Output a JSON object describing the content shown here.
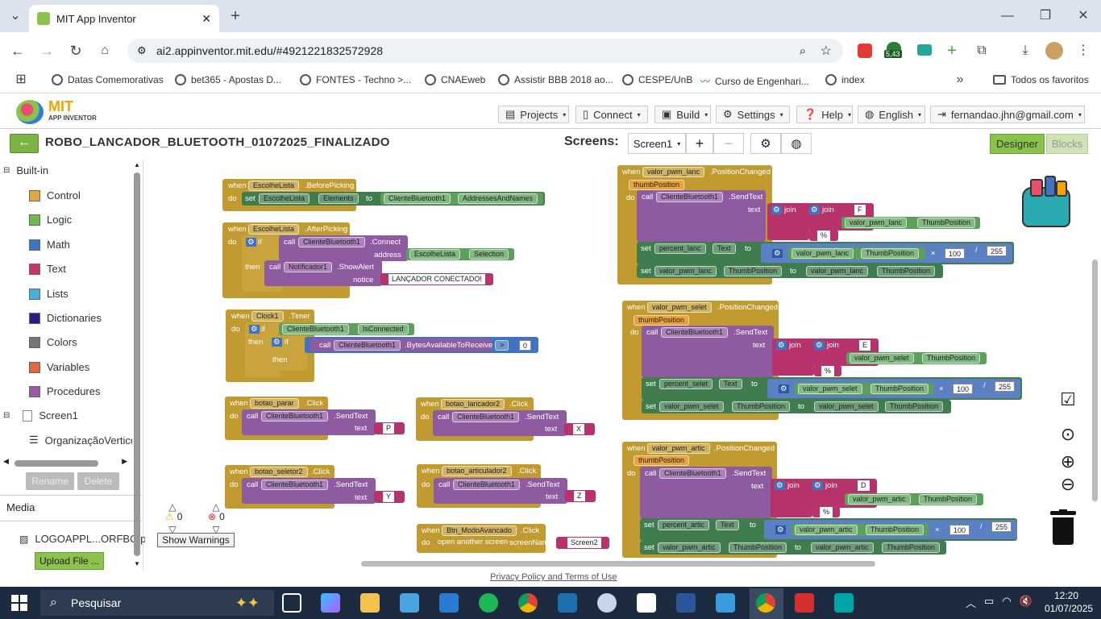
{
  "browser": {
    "tab_title": "MIT App Inventor",
    "url": "ai2.appinventor.mit.edu/#4921221832572928",
    "ext_badge": "5,43",
    "bookmarks": [
      "Datas Comemorativas",
      "bet365 - Apostas D...",
      "FONTES - Techno >...",
      "CNAEweb",
      "Assistir BBB 2018 ao...",
      "CESPE/UnB",
      "Curso de Engenhari...",
      "index"
    ],
    "all_bookmarks": "Todos os favoritos"
  },
  "app": {
    "logo_title": "MIT",
    "logo_sub": "APP INVENTOR",
    "menus": [
      "Projects",
      "Connect",
      "Build",
      "Settings",
      "Help",
      "English",
      "fernandao.jhn@gmail.com"
    ],
    "project_name": "ROBO_LANCADOR_BLUETOOTH_01072025_FINALIZADO",
    "screens_label": "Screens:",
    "screen_select": "Screen1",
    "designer": "Designer",
    "blocks": "Blocks"
  },
  "left": {
    "builtin": "Built-in",
    "categories": [
      {
        "label": "Control",
        "color": "#e0a83a"
      },
      {
        "label": "Logic",
        "color": "#6dbb4a"
      },
      {
        "label": "Math",
        "color": "#3f74c3"
      },
      {
        "label": "Text",
        "color": "#c8356d"
      },
      {
        "label": "Lists",
        "color": "#45b0d9"
      },
      {
        "label": "Dictionaries",
        "color": "#2a1b8e"
      },
      {
        "label": "Colors",
        "color": "#777777"
      },
      {
        "label": "Variables",
        "color": "#e2673a"
      },
      {
        "label": "Procedures",
        "color": "#9a5aa8"
      }
    ],
    "screen1": "Screen1",
    "org": "OrganizaçãoVertico",
    "rename": "Rename",
    "delete": "Delete",
    "media": "Media",
    "media_file": "LOGOAPPL...ORFBC.png",
    "upload": "Upload File ..."
  },
  "workspace": {
    "warnings": "0",
    "errors": "0",
    "show_warnings": "Show Warnings",
    "privacy": "Privacy Policy and Terms of Use",
    "b1": {
      "when": "when",
      "comp": "EscolheLista",
      "event": ".BeforePicking",
      "do": "do",
      "set": "set",
      "comp2": "EscolheLista",
      "prop": "Elements",
      "to": "to",
      "comp3": "ClienteBluetooth1",
      "prop2": "AddressesAndNames"
    },
    "b2": {
      "when": "when",
      "comp": "EscolheLista",
      "event": ".AfterPicking",
      "do": "do",
      "if": "if",
      "call": "call",
      "comp2": "ClienteBluetooth1",
      "method": ".Connect",
      "address": "address",
      "comp3": "EscolheLista",
      "prop": "Selection",
      "then": "then",
      "comp4": "Notificador1",
      "method2": ".ShowAlert",
      "notice": "notice",
      "text": "LANÇADOR CONECTADO!"
    },
    "b3": {
      "when": "when",
      "comp": "Clock1",
      "event": ".Timer",
      "do": "do",
      "if": "if",
      "comp2": "ClienteBluetooth1",
      "prop": "IsConnected",
      "then": "then",
      "if2": "if",
      "call": "call",
      "comp3": "ClienteBluetooth1",
      "method": ".BytesAvailableToReceive",
      "op": ">",
      "num": "0",
      "then2": "then"
    },
    "b4": {
      "when": "when",
      "comp": "botao_parar",
      "event": ".Click",
      "do": "do",
      "call": "call",
      "comp2": "ClienteBluetooth1",
      "method": ".SendText",
      "text": "text",
      "val": "P"
    },
    "b5": {
      "when": "when",
      "comp": "botao_lancador2",
      "event": ".Click",
      "do": "do",
      "call": "call",
      "comp2": "ClienteBluetooth1",
      "method": ".SendText",
      "text": "text",
      "val": "X"
    },
    "b6": {
      "when": "when",
      "comp": "botao_seletor2",
      "event": ".Click",
      "do": "do",
      "call": "call",
      "comp2": "ClienteBluetooth1",
      "method": ".SendText",
      "text": "text",
      "val": "Y"
    },
    "b7": {
      "when": "when",
      "comp": "botao_articulador2",
      "event": ".Click",
      "do": "do",
      "call": "call",
      "comp2": "ClienteBluetooth1",
      "method": ".SendText",
      "text": "text",
      "val": "Z"
    },
    "b8": {
      "when": "when",
      "comp": "Btn_ModoAvancado",
      "event": ".Click",
      "do": "do",
      "action": "open another screen",
      "screenName": "screenName",
      "val": "Screen2"
    },
    "b9": {
      "when": "when",
      "comp": "valor_pwm_lanc",
      "event": ".PositionChanged",
      "param": "thumbPosition",
      "do": "do",
      "call": "call",
      "comp2": "ClienteBluetooth1",
      "method": ".SendText",
      "text": "text",
      "join": "join",
      "join2": "join",
      "s1": "F",
      "comp3": "valor_pwm_lanc",
      "prop": "ThumbPosition",
      "s2": "%",
      "set": "set",
      "comp4": "percent_lanc",
      "prop2": "Text",
      "to": "to",
      "comp5": "valor_pwm_lanc",
      "prop3": "ThumbPosition",
      "times": "×",
      "n1": "100",
      "div": "/",
      "n2": "255",
      "set2": "set",
      "comp6": "valor_pwm_lanc",
      "prop4": "ThumbPosition",
      "to2": "to",
      "comp7": "valor_pwm_lanc",
      "prop5": "ThumbPosition"
    },
    "b10": {
      "when": "when",
      "comp": "valor_pwm_selet",
      "event": ".PositionChanged",
      "param": "thumbPosition",
      "do": "do",
      "call": "call",
      "comp2": "ClienteBluetooth1",
      "method": ".SendText",
      "text": "text",
      "join": "join",
      "join2": "join",
      "s1": "E",
      "comp3": "valor_pwm_selet",
      "prop": "ThumbPosition",
      "s2": "%",
      "set": "set",
      "comp4": "percent_selet",
      "prop2": "Text",
      "to": "to",
      "comp5": "valor_pwm_selet",
      "prop3": "ThumbPosition",
      "times": "×",
      "n1": "100",
      "div": "/",
      "n2": "255",
      "set2": "set",
      "comp6": "valor_pwm_selet",
      "prop4": "ThumbPosition",
      "to2": "to",
      "comp7": "valor_pwm_selet",
      "prop5": "ThumbPosition"
    },
    "b11": {
      "when": "when",
      "comp": "valor_pwm_artic",
      "event": ".PositionChanged",
      "param": "thumbPosition",
      "do": "do",
      "call": "call",
      "comp2": "ClienteBluetooth1",
      "method": ".SendText",
      "text": "text",
      "join": "join",
      "join2": "join",
      "s1": "D",
      "comp3": "valor_pwm_artic",
      "prop": "ThumbPosition",
      "s2": "%",
      "set": "set",
      "comp4": "percent_artic",
      "prop2": "Text",
      "to": "to",
      "comp5": "valor_pwm_artic",
      "prop3": "ThumbPosition",
      "times": "×",
      "n1": "100",
      "div": "/",
      "n2": "255",
      "set2": "set",
      "comp6": "valor_pwm_artic",
      "prop4": "ThumbPosition",
      "to2": "to",
      "comp7": "valor_pwm_artic",
      "prop5": "ThumbPosition"
    }
  },
  "taskbar": {
    "search": "Pesquisar",
    "time": "12:20",
    "date": "01/07/2025"
  }
}
